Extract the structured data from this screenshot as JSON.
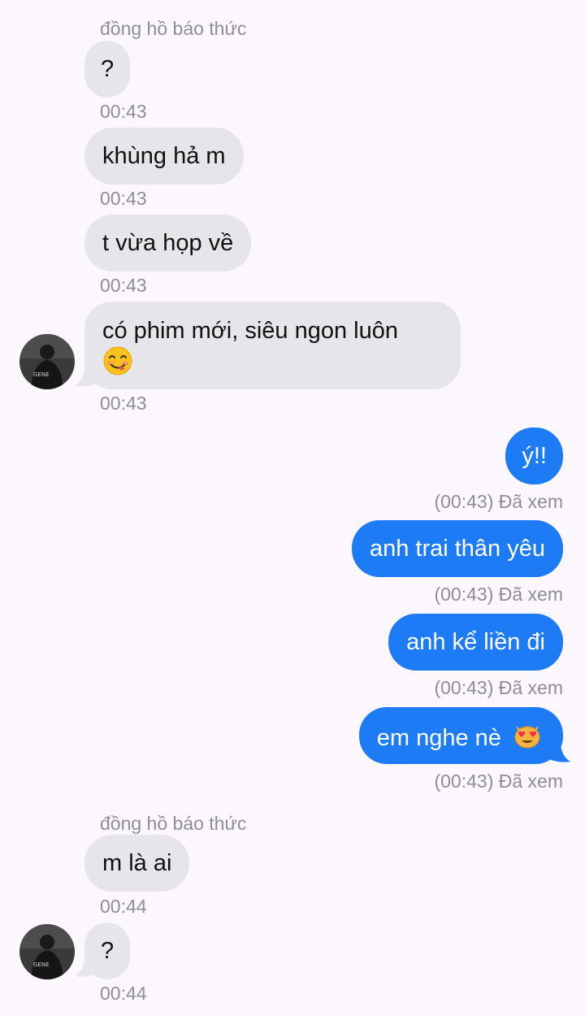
{
  "conversation": {
    "sender_name": "đồng hồ báo thức",
    "messages": [
      {
        "id": "m1",
        "text": "?",
        "time": "00:43"
      },
      {
        "id": "m2",
        "text": "khùng hả m",
        "time": "00:43"
      },
      {
        "id": "m3",
        "text": "t vừa họp về",
        "time": "00:43"
      },
      {
        "id": "m4",
        "text": "có phim mới, siêu ngon luôn",
        "time": "00:43",
        "emoji": "face-savoring-food"
      },
      {
        "id": "m5",
        "text": "ý!!",
        "status": "(00:43) Đã xem"
      },
      {
        "id": "m6",
        "text": "anh trai thân yêu",
        "status": "(00:43) Đã xem"
      },
      {
        "id": "m7",
        "text": "anh kể liền đi",
        "status": "(00:43) Đã xem"
      },
      {
        "id": "m8",
        "text": "em nghe nè",
        "status": "(00:43) Đã xem",
        "emoji": "smiling-cat-heart-eyes"
      },
      {
        "id": "m9",
        "text": "m là ai",
        "time": "00:44"
      },
      {
        "id": "m10",
        "text": "?",
        "time": "00:44"
      }
    ]
  },
  "avatar": {
    "badge_text": "GENE",
    "icon": "profile-photo"
  },
  "colors": {
    "background": "#fcf7fc",
    "incoming_bubble": "#e6e6ea",
    "outgoing_bubble": "#1d7bf5",
    "meta_text": "#8e8e93"
  }
}
